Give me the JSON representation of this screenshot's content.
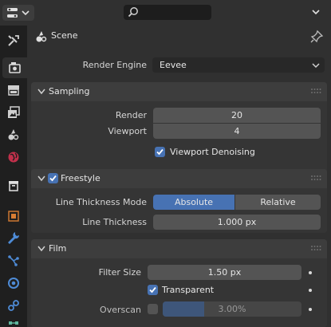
{
  "header": {
    "search_placeholder": ""
  },
  "scene": {
    "title": "Scene"
  },
  "render_engine": {
    "label": "Render Engine",
    "value": "Eevee"
  },
  "sampling": {
    "title": "Sampling",
    "render_label": "Render",
    "render_value": "20",
    "viewport_label": "Viewport",
    "viewport_value": "4",
    "denoise_label": "Viewport Denoising",
    "denoise_checked": true
  },
  "freestyle": {
    "title": "Freestyle",
    "enabled": true,
    "mode_label": "Line Thickness Mode",
    "mode_options": [
      "Absolute",
      "Relative"
    ],
    "mode_selected": "Absolute",
    "thickness_label": "Line Thickness",
    "thickness_value": "1.000 px"
  },
  "film": {
    "title": "Film",
    "filter_label": "Filter Size",
    "filter_value": "1.50 px",
    "transparent_label": "Transparent",
    "transparent_checked": true,
    "overscan_label": "Overscan",
    "overscan_enabled": false,
    "overscan_value": "3.00%",
    "overscan_fraction": 0.3
  },
  "colors": {
    "accent": "#4772b3",
    "panel": "#3d3d3d",
    "background": "#303030",
    "field": "#545454"
  },
  "tabs": [
    "tool-icon",
    "render-icon",
    "output-icon",
    "view-layer-icon",
    "scene-icon",
    "world-icon",
    "collection-icon",
    "object-icon",
    "modifier-icon",
    "particles-icon",
    "physics-icon",
    "constraints-icon",
    "data-icon"
  ]
}
